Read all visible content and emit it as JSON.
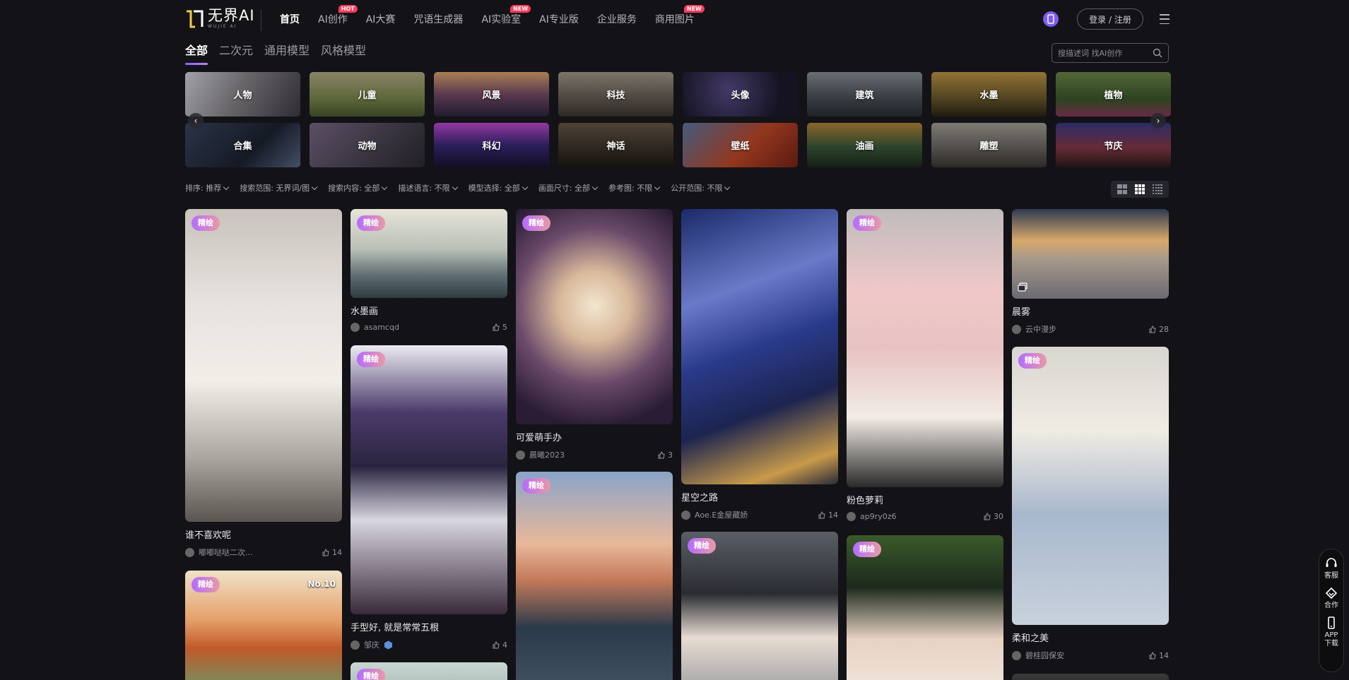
{
  "nav": {
    "logo_text": "无界AI",
    "logo_sub": "WUJIE AI",
    "items": [
      {
        "label": "首页"
      },
      {
        "label": "AI创作",
        "badge": "HOT"
      },
      {
        "label": "AI大赛"
      },
      {
        "label": "咒语生成器"
      },
      {
        "label": "AI实验室",
        "badge": "NEW"
      },
      {
        "label": "AI专业版"
      },
      {
        "label": "企业服务"
      },
      {
        "label": "商用图片",
        "badge": "NEW"
      }
    ],
    "login_label": "登录 / 注册",
    "accent_color": "#7b5cf5",
    "badge_color": "#ff3b5c"
  },
  "category_tabs": [
    "全部",
    "二次元",
    "通用模型",
    "风格模型"
  ],
  "search": {
    "placeholder": "搜描述词 找AI创作"
  },
  "themes": [
    "人物",
    "儿童",
    "风景",
    "科技",
    "头像",
    "建筑",
    "水墨",
    "植物",
    "合集",
    "动物",
    "科幻",
    "神话",
    "壁纸",
    "油画",
    "雕塑",
    "节庆"
  ],
  "filters": [
    {
      "label": "排序:",
      "value": "推荐"
    },
    {
      "label": "搜索范围:",
      "value": "无界词/图"
    },
    {
      "label": "搜索内容:",
      "value": "全部"
    },
    {
      "label": "描述语言:",
      "value": "不限"
    },
    {
      "label": "模型选择:",
      "value": "全部"
    },
    {
      "label": "画面尺寸:",
      "value": "全部"
    },
    {
      "label": "参考图:",
      "value": "不限"
    },
    {
      "label": "公开范围:",
      "value": "不限"
    }
  ],
  "badge_label": "精绘",
  "cards": [
    {
      "title": "谁不喜欢呢",
      "author": "嘟嘟哒哒二次...",
      "likes": "14"
    },
    {
      "title": "",
      "author": "",
      "likes": "",
      "rank": "No.10"
    },
    {
      "title": "水墨画",
      "author": "asamcqd",
      "likes": "5"
    },
    {
      "title": "手型好, 就是常常五根",
      "author": "邹庆",
      "likes": "4"
    },
    {
      "title": "",
      "author": "",
      "likes": ""
    },
    {
      "title": "可爱萌手办",
      "author": "晨曦2023",
      "likes": "3"
    },
    {
      "title": "",
      "author": "",
      "likes": ""
    },
    {
      "title": "星空之路",
      "author": "Aoe.E金屋藏娇",
      "likes": "14"
    },
    {
      "title": "",
      "author": "",
      "likes": ""
    },
    {
      "title": "粉色萝莉",
      "author": "ap9ry0z6",
      "likes": "30"
    },
    {
      "title": "",
      "author": "",
      "likes": ""
    },
    {
      "title": "晨雾",
      "author": "云中漫步",
      "likes": "28"
    },
    {
      "title": "柔和之美",
      "author": "碧桂园保安",
      "likes": "14"
    },
    {
      "title": "",
      "author": "",
      "likes": ""
    }
  ],
  "side": {
    "service": "客服",
    "cooperate": "合作",
    "app": "APP",
    "download": "下载"
  }
}
